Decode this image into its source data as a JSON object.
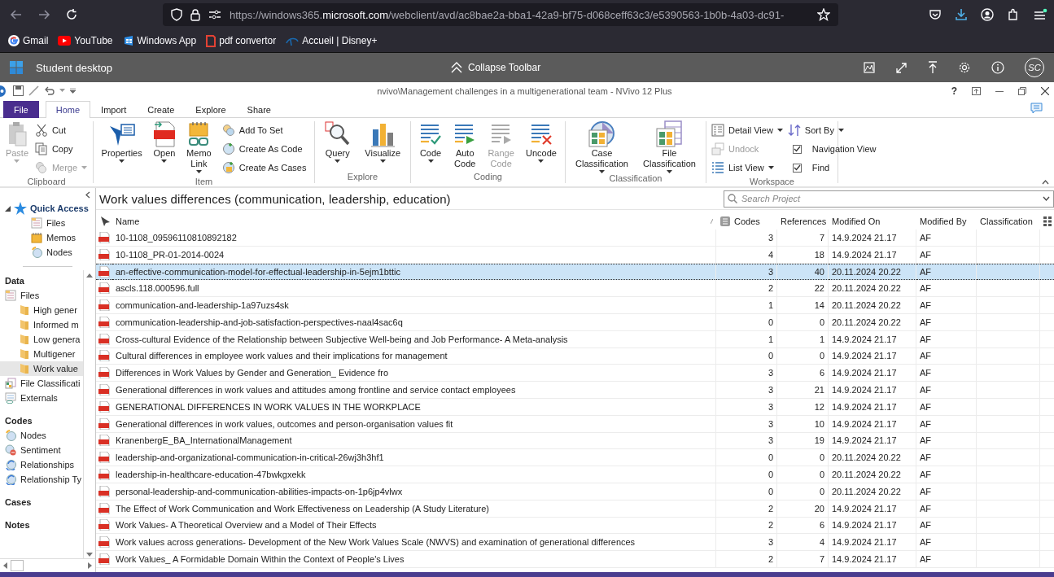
{
  "browser": {
    "url": "https://windows365.**microsoft.com**/webclient/avd/ac8bae2a-bba1-42a9-bf75-d068ceff63c3/e5390563-1b0b-4a03-dc91-",
    "bookmarks": [
      {
        "label": "Gmail",
        "kind": "google"
      },
      {
        "label": "YouTube",
        "kind": "video"
      },
      {
        "label": "Windows App",
        "kind": "windows"
      },
      {
        "label": "pdf convertor",
        "kind": "pdf"
      },
      {
        "label": "Accueil | Disney+",
        "kind": "stream"
      }
    ]
  },
  "remote": {
    "title": "Student desktop",
    "collapse": "Collapse Toolbar",
    "avatar": "SC"
  },
  "app": {
    "title": "nvivo\\Management challenges in a multigenerational team - NVivo 12 Plus",
    "help": "?"
  },
  "ribbon": {
    "tabs": [
      {
        "label": "File",
        "kind": "file",
        "selected": false
      },
      {
        "label": "Home",
        "kind": "tab",
        "selected": true
      },
      {
        "label": "Import",
        "kind": "tab",
        "selected": false
      },
      {
        "label": "Create",
        "kind": "tab",
        "selected": false
      },
      {
        "label": "Explore",
        "kind": "tab",
        "selected": false
      },
      {
        "label": "Share",
        "kind": "tab",
        "selected": false
      }
    ],
    "groups": [
      {
        "label": "Clipboard",
        "items": [
          {
            "kind": "large",
            "label": "Paste",
            "disabled": true,
            "dropdown": true
          },
          {
            "kind": "stack",
            "items": [
              {
                "kind": "small",
                "label": "Cut",
                "disabled": false,
                "dropdown": false
              },
              {
                "kind": "small",
                "label": "Copy",
                "disabled": false,
                "dropdown": false
              },
              {
                "kind": "small",
                "label": "Merge",
                "disabled": true,
                "dropdown": true
              }
            ]
          }
        ]
      },
      {
        "label": "Item",
        "items": [
          {
            "kind": "large",
            "label": "Properties",
            "disabled": false,
            "dropdown": true
          },
          {
            "kind": "large",
            "label": "Open",
            "disabled": false,
            "dropdown": true
          },
          {
            "kind": "large",
            "label": "Memo Link",
            "disabled": false,
            "dropdown": true
          },
          {
            "kind": "stack",
            "items": [
              {
                "kind": "small",
                "label": "Add To Set",
                "disabled": false,
                "dropdown": false
              },
              {
                "kind": "small",
                "label": "Create As Code",
                "disabled": false,
                "dropdown": false
              },
              {
                "kind": "small",
                "label": "Create As Cases",
                "disabled": false,
                "dropdown": false
              }
            ]
          }
        ]
      },
      {
        "label": "Explore",
        "items": [
          {
            "kind": "large",
            "label": "Query",
            "disabled": false,
            "dropdown": true
          },
          {
            "kind": "large",
            "label": "Visualize",
            "disabled": false,
            "dropdown": true
          }
        ]
      },
      {
        "label": "Coding",
        "items": [
          {
            "kind": "large",
            "label": "Code",
            "disabled": false,
            "dropdown": true
          },
          {
            "kind": "large",
            "label": "Auto Code",
            "disabled": false,
            "dropdown": false
          },
          {
            "kind": "large",
            "label": "Range Code",
            "disabled": true,
            "dropdown": false
          },
          {
            "kind": "large",
            "label": "Uncode",
            "disabled": false,
            "dropdown": true
          }
        ]
      },
      {
        "label": "Classification",
        "items": [
          {
            "kind": "large",
            "label": "Case Classification",
            "disabled": false,
            "dropdown": true
          },
          {
            "kind": "large",
            "label": "File Classification",
            "disabled": false,
            "dropdown": true
          }
        ]
      },
      {
        "label": "Workspace",
        "items": [
          {
            "kind": "stack",
            "items": [
              {
                "kind": "small",
                "label": "Detail View",
                "disabled": false,
                "dropdown": true
              },
              {
                "kind": "small",
                "label": "Undock",
                "disabled": true,
                "dropdown": false
              },
              {
                "kind": "small",
                "label": "List View",
                "disabled": false,
                "dropdown": true
              }
            ]
          },
          {
            "kind": "stack",
            "items": [
              {
                "kind": "small",
                "label": "Sort By",
                "disabled": false,
                "dropdown": true
              },
              {
                "kind": "check",
                "label": "Navigation View",
                "checked": true
              },
              {
                "kind": "check",
                "label": "Find",
                "checked": true
              }
            ]
          }
        ]
      }
    ]
  },
  "nav": {
    "quick_access": {
      "label": "Quick Access",
      "expanded": true,
      "children": [
        {
          "label": "Files",
          "kind": "files",
          "selected": false
        },
        {
          "label": "Memos",
          "kind": "memos",
          "selected": false
        },
        {
          "label": "Nodes",
          "kind": "nodes",
          "selected": false
        }
      ]
    },
    "sections": [
      {
        "heading": "Data",
        "items": [
          {
            "label": "Files",
            "kind": "files",
            "selected": false,
            "children": [
              {
                "label": "High gener",
                "kind": "folder",
                "selected": false
              },
              {
                "label": "Informed m",
                "kind": "folder",
                "selected": false
              },
              {
                "label": "Low genera",
                "kind": "folder",
                "selected": false
              },
              {
                "label": "Multigener",
                "kind": "folder",
                "selected": false
              },
              {
                "label": "Work value",
                "kind": "folder",
                "selected": true
              }
            ]
          },
          {
            "label": "File Classificati",
            "kind": "classification",
            "selected": false
          },
          {
            "label": "Externals",
            "kind": "externals",
            "selected": false
          }
        ]
      },
      {
        "heading": "Codes",
        "items": [
          {
            "label": "Nodes",
            "kind": "nodes",
            "selected": false
          },
          {
            "label": "Sentiment",
            "kind": "sentiment",
            "selected": false
          },
          {
            "label": "Relationships",
            "kind": "relationships",
            "selected": false
          },
          {
            "label": "Relationship Ty",
            "kind": "relationships",
            "selected": false
          }
        ]
      },
      {
        "heading": "Cases"
      },
      {
        "heading": "Notes"
      }
    ]
  },
  "list": {
    "title": "Work values differences (communication, leadership, education)",
    "search_placeholder": "Search Project",
    "columns": [
      "Name",
      "Codes",
      "References",
      "Modified On",
      "Modified By",
      "Classification"
    ],
    "rows": [
      {
        "name": "10-1108_09596110810892182",
        "codes": "3",
        "references": "7",
        "modified_on": "14.9.2024 21.17",
        "modified_by": "AF",
        "selected": false
      },
      {
        "name": "10-1108_PR-01-2014-0024",
        "codes": "4",
        "references": "18",
        "modified_on": "14.9.2024 21.17",
        "modified_by": "AF",
        "selected": false
      },
      {
        "name": "an-effective-communication-model-for-effectual-leadership-in-5ejm1bttic",
        "codes": "3",
        "references": "40",
        "modified_on": "20.11.2024 20.22",
        "modified_by": "AF",
        "selected": true
      },
      {
        "name": "ascls.118.000596.full",
        "codes": "2",
        "references": "22",
        "modified_on": "20.11.2024 20.22",
        "modified_by": "AF",
        "selected": false
      },
      {
        "name": "communication-and-leadership-1a97uzs4sk",
        "codes": "1",
        "references": "14",
        "modified_on": "20.11.2024 20.22",
        "modified_by": "AF",
        "selected": false
      },
      {
        "name": "communication-leadership-and-job-satisfaction-perspectives-naal4sac6q",
        "codes": "0",
        "references": "0",
        "modified_on": "20.11.2024 20.22",
        "modified_by": "AF",
        "selected": false
      },
      {
        "name": "Cross-cultural Evidence of the Relationship between Subjective Well-being and Job Performance- A Meta-analysis",
        "codes": "1",
        "references": "1",
        "modified_on": "14.9.2024 21.17",
        "modified_by": "AF",
        "selected": false
      },
      {
        "name": "Cultural differences in employee work values and their implications for management",
        "codes": "0",
        "references": "0",
        "modified_on": "14.9.2024 21.17",
        "modified_by": "AF",
        "selected": false
      },
      {
        "name": "Differences in Work Values by Gender and Generation_ Evidence fro",
        "codes": "3",
        "references": "6",
        "modified_on": "14.9.2024 21.17",
        "modified_by": "AF",
        "selected": false
      },
      {
        "name": "Generational differences in work values and attitudes among frontline and service contact employees",
        "codes": "3",
        "references": "21",
        "modified_on": "14.9.2024 21.17",
        "modified_by": "AF",
        "selected": false
      },
      {
        "name": "GENERATIONAL DIFFERENCES IN WORK VALUES IN THE WORKPLACE",
        "codes": "3",
        "references": "12",
        "modified_on": "14.9.2024 21.17",
        "modified_by": "AF",
        "selected": false
      },
      {
        "name": "Generational differences in work values, outcomes and person-organisation values fit",
        "codes": "3",
        "references": "10",
        "modified_on": "14.9.2024 21.17",
        "modified_by": "AF",
        "selected": false
      },
      {
        "name": "KranenbergE_BA_InternationalManagement",
        "codes": "3",
        "references": "19",
        "modified_on": "14.9.2024 21.17",
        "modified_by": "AF",
        "selected": false
      },
      {
        "name": "leadership-and-organizational-communication-in-critical-26wj3h3hf1",
        "codes": "0",
        "references": "0",
        "modified_on": "20.11.2024 20.22",
        "modified_by": "AF",
        "selected": false
      },
      {
        "name": "leadership-in-healthcare-education-47bwkgxekk",
        "codes": "0",
        "references": "0",
        "modified_on": "20.11.2024 20.22",
        "modified_by": "AF",
        "selected": false
      },
      {
        "name": "personal-leadership-and-communication-abilities-impacts-on-1p6jp4vlwx",
        "codes": "0",
        "references": "0",
        "modified_on": "20.11.2024 20.22",
        "modified_by": "AF",
        "selected": false
      },
      {
        "name": "The Effect of Work Communication and Work Effectiveness on Leadership (A Study Literature)",
        "codes": "2",
        "references": "20",
        "modified_on": "14.9.2024 21.17",
        "modified_by": "AF",
        "selected": false
      },
      {
        "name": "Work Values- A Theoretical Overview and a Model of Their Effects",
        "codes": "2",
        "references": "6",
        "modified_on": "14.9.2024 21.17",
        "modified_by": "AF",
        "selected": false
      },
      {
        "name": "Work values across generations- Development of the New Work Values Scale (NWVS) and examination of generational differences",
        "codes": "3",
        "references": "4",
        "modified_on": "14.9.2024 21.17",
        "modified_by": "AF",
        "selected": false
      },
      {
        "name": "Work Values_ A Formidable Domain Within the Context of People's Lives",
        "codes": "2",
        "references": "7",
        "modified_on": "14.9.2024 21.17",
        "modified_by": "AF",
        "selected": false
      }
    ]
  }
}
